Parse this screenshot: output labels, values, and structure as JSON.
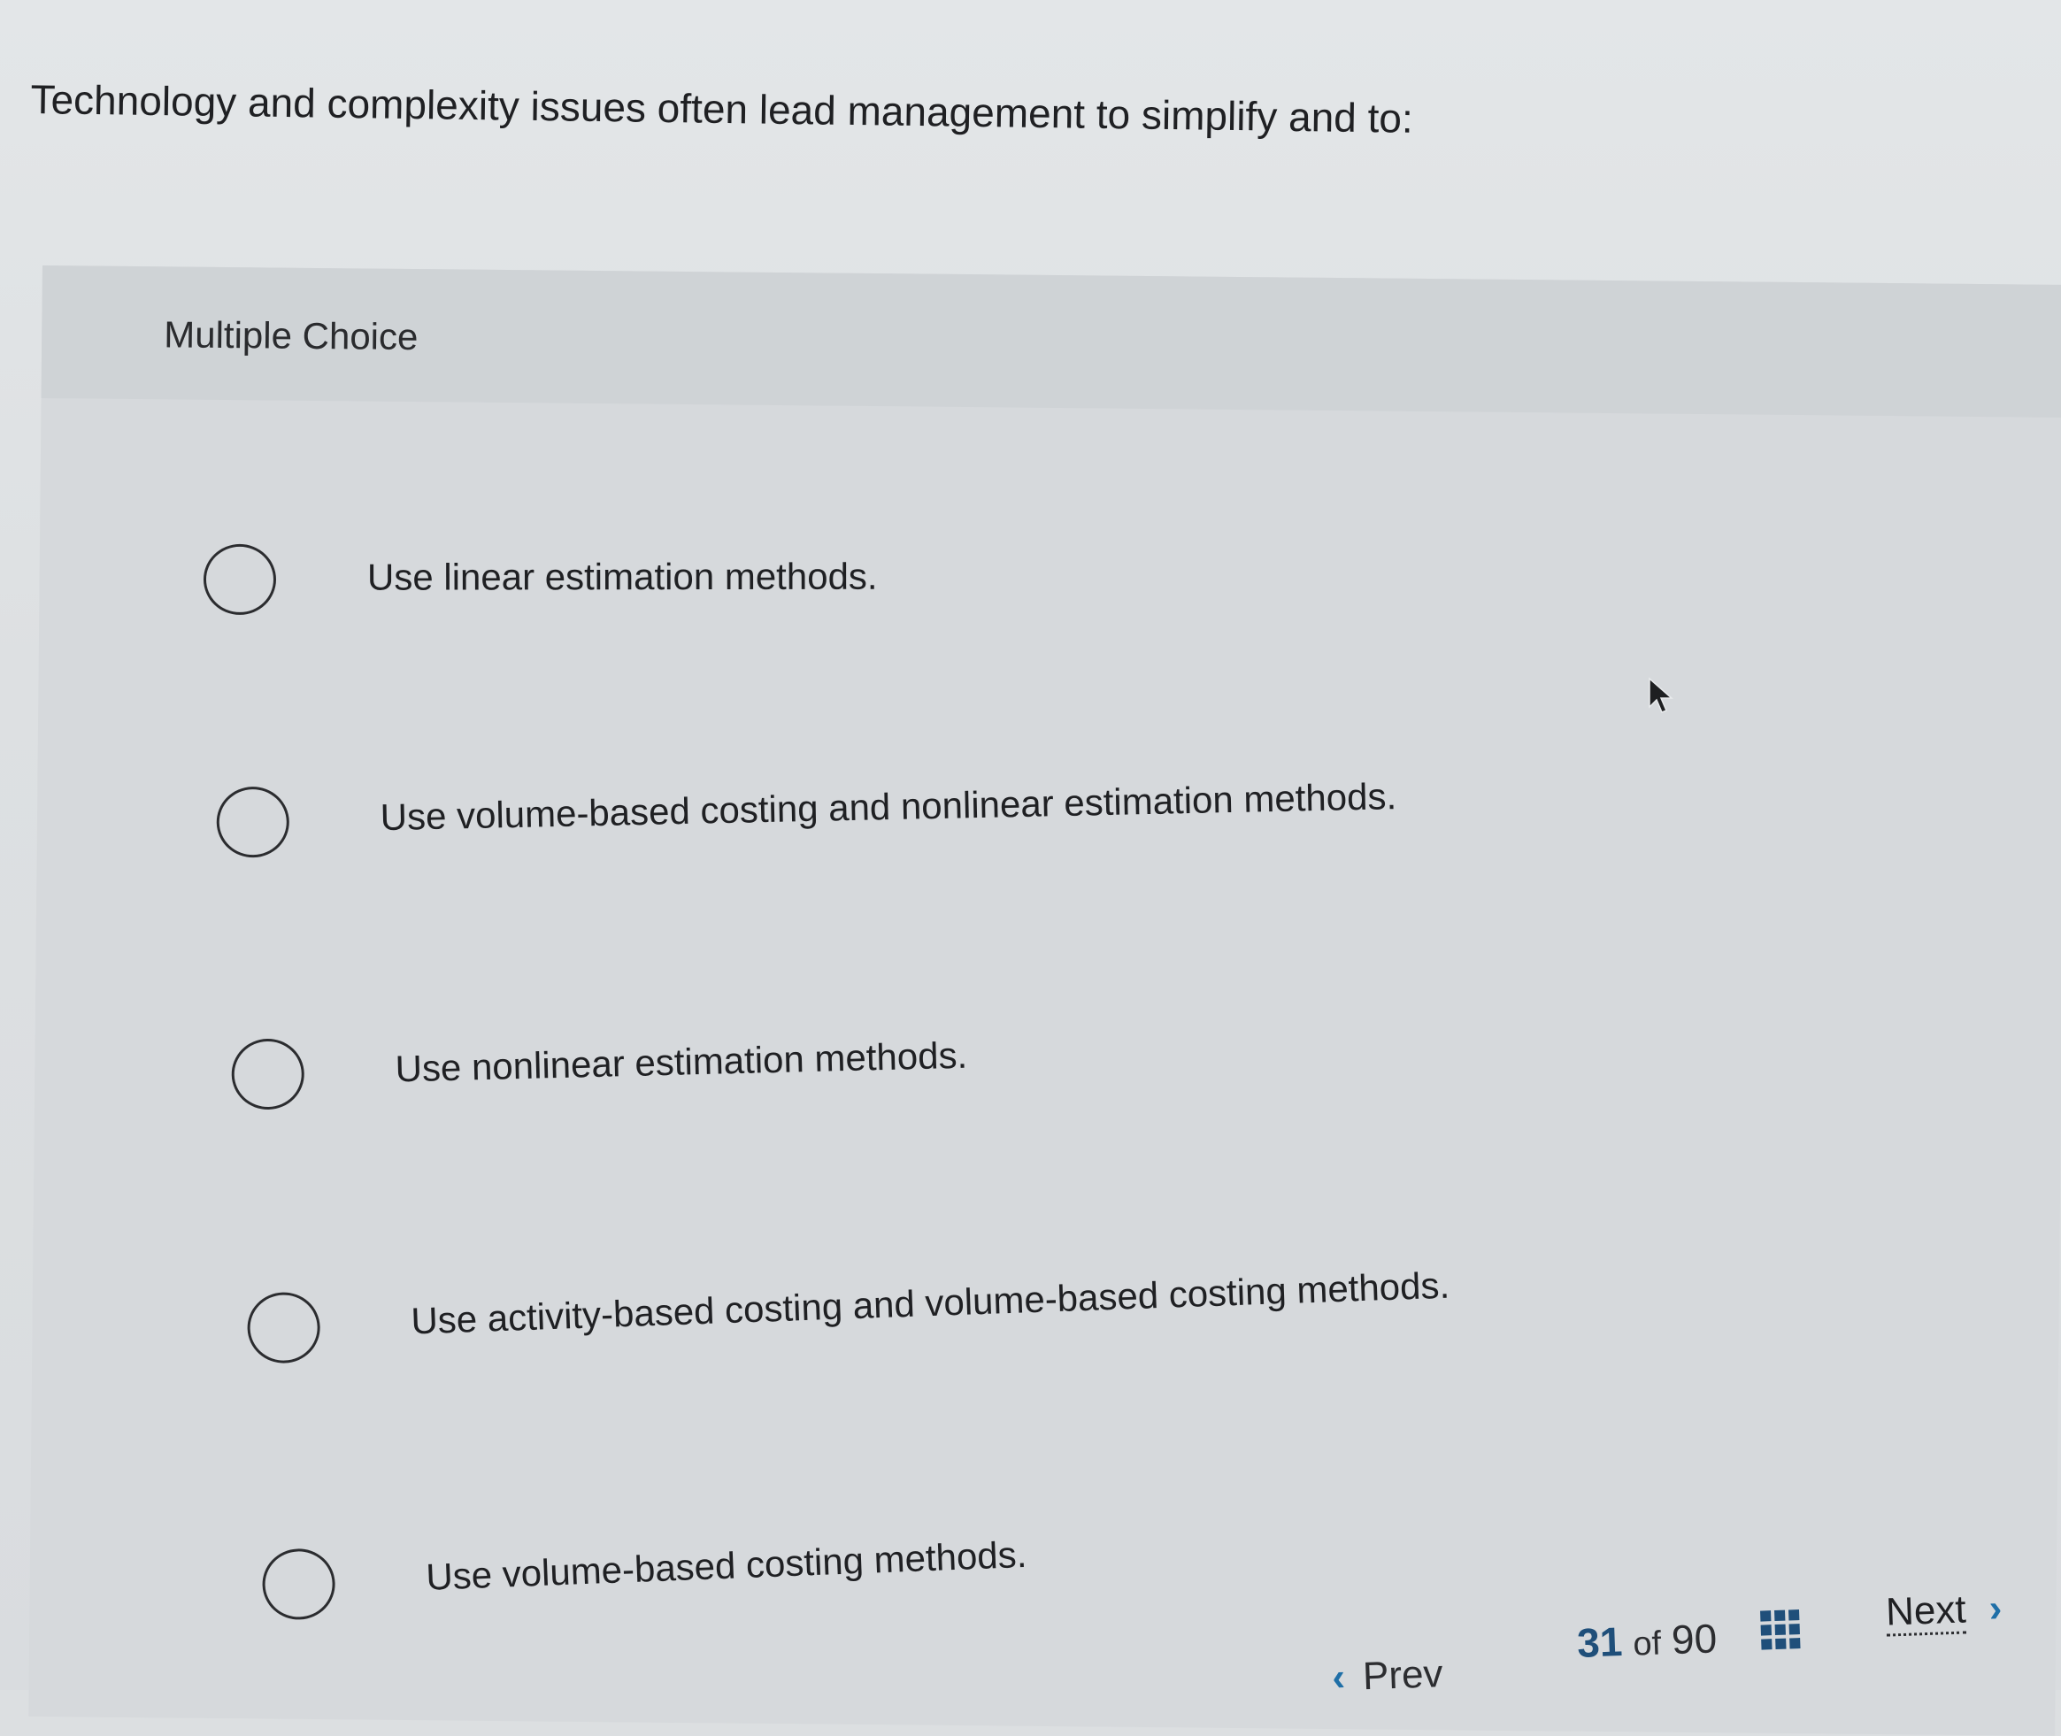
{
  "question": {
    "text": "Technology and complexity issues often lead management to simplify and to:"
  },
  "card": {
    "type_label": "Multiple Choice"
  },
  "options": [
    {
      "label": "Use linear estimation methods.",
      "selected": false
    },
    {
      "label": "Use volume-based costing and nonlinear estimation methods.",
      "selected": false
    },
    {
      "label": "Use nonlinear estimation methods.",
      "selected": false
    },
    {
      "label": "Use activity-based costing and volume-based costing methods.",
      "selected": false
    },
    {
      "label": "Use volume-based costing methods.",
      "selected": false
    }
  ],
  "footer": {
    "prev_label": "Prev",
    "prev_icon": "chevron-left-icon",
    "current_page": "31",
    "of_label": "of",
    "total_pages": "90",
    "grid_icon": "question-grid-icon",
    "next_label": "Next",
    "next_icon": "chevron-right-icon"
  },
  "colors": {
    "accent": "#1f6fa7",
    "pager_number": "#1f4f7a",
    "text": "#1f2023"
  }
}
